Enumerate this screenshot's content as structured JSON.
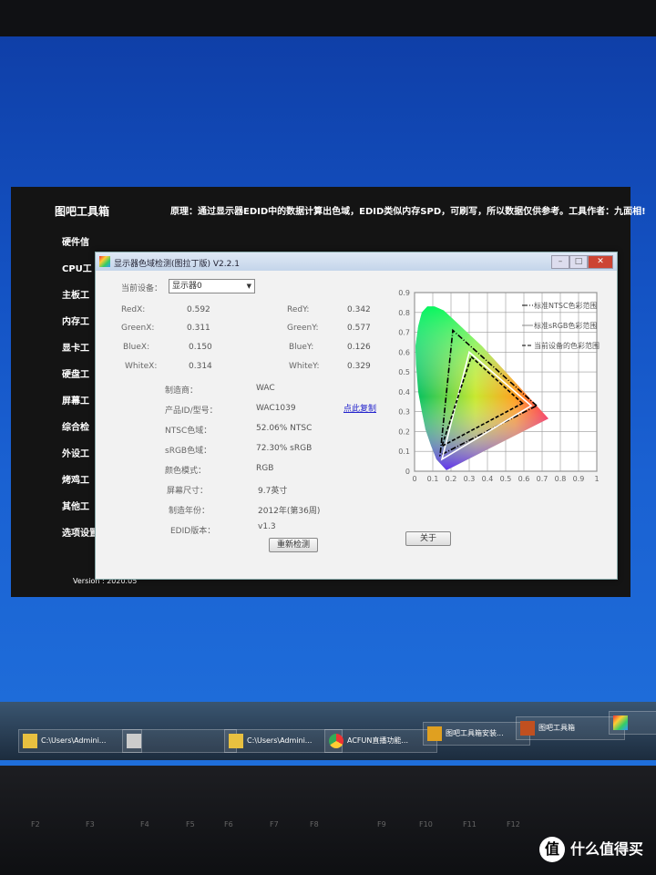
{
  "toolbox": {
    "title": "图吧工具箱",
    "principle": "原理：通过显示器EDID中的数据计算出色域，EDID类似内存SPD，可刷写，所以数据仅供参考。工具作者：九面相!",
    "menu": [
      "硬件信",
      "CPU工",
      "主板工",
      "内存工",
      "显卡工",
      "硬盘工",
      "屏幕工",
      "综合检",
      "外设工",
      "烤鸡工",
      "其他工",
      "选项设置"
    ],
    "version": "Version : 2020.05"
  },
  "dialog": {
    "title": "显示器色域检测(图拉丁版) V2.2.1",
    "device_label": "当前设备：",
    "device_value": "显示器0",
    "coords": {
      "redx_label": "RedX:",
      "redx": "0.592",
      "redy_label": "RedY:",
      "redy": "0.342",
      "greenx_label": "GreenX:",
      "greenx": "0.311",
      "greeny_label": "GreenY:",
      "greeny": "0.577",
      "bluex_label": "BlueX:",
      "bluex": "0.150",
      "bluey_label": "BlueY:",
      "bluey": "0.126",
      "whitex_label": "WhiteX:",
      "whitex": "0.314",
      "whitey_label": "WhiteY:",
      "whitey": "0.329"
    },
    "info": [
      {
        "label": "制造商：",
        "value": "WAC"
      },
      {
        "label": "产品ID/型号：",
        "value": "WAC1039"
      },
      {
        "label": "NTSC色域：",
        "value": "52.06% NTSC"
      },
      {
        "label": "sRGB色域：",
        "value": "72.30% sRGB"
      },
      {
        "label": "颜色模式：",
        "value": "RGB"
      },
      {
        "label": "屏幕尺寸：",
        "value": "9.7英寸"
      },
      {
        "label": "制造年份：",
        "value": "2012年(第36周)"
      },
      {
        "label": "EDID版本：",
        "value": "v1.3"
      }
    ],
    "copy_link": "点此复制",
    "recheck_button": "重新检测",
    "about_button": "关于"
  },
  "chart_data": {
    "type": "scatter",
    "xlim": [
      0,
      1
    ],
    "ylim": [
      0,
      0.9
    ],
    "x_ticks": [
      "0",
      "0.1",
      "0.2",
      "0.3",
      "0.4",
      "0.5",
      "0.6",
      "0.7",
      "0.8",
      "0.9",
      "1"
    ],
    "y_ticks": [
      "0",
      "0.1",
      "0.2",
      "0.3",
      "0.4",
      "0.5",
      "0.6",
      "0.7",
      "0.8",
      "0.9"
    ],
    "grid": true,
    "legend": [
      "标准NTSC色彩范围",
      "标准sRGB色彩范围",
      "当前设备的色彩范围"
    ],
    "legend_position": "top-right",
    "series": [
      {
        "name": "标准NTSC色彩范围",
        "style": "dash-dot",
        "color": "#000000",
        "x": [
          0.67,
          0.21,
          0.14
        ],
        "y": [
          0.33,
          0.71,
          0.08
        ]
      },
      {
        "name": "标准sRGB色彩范围",
        "style": "solid",
        "color": "#ffffff",
        "x": [
          0.64,
          0.3,
          0.15
        ],
        "y": [
          0.33,
          0.6,
          0.06
        ]
      },
      {
        "name": "当前设备的色彩范围",
        "style": "dashed",
        "color": "#000000",
        "x": [
          0.592,
          0.311,
          0.15
        ],
        "y": [
          0.342,
          0.577,
          0.126
        ]
      }
    ]
  },
  "taskbar": {
    "items": [
      "C:\\Users\\Admini...",
      "",
      "C:\\Users\\Admini...",
      "ACFUN直播功能...",
      "图吧工具箱安装...",
      "图吧工具箱",
      ""
    ]
  },
  "keyboard": {
    "keys": [
      "F2",
      "F3",
      "F4",
      "F5",
      "F6",
      "F7",
      "F8",
      "F9",
      "F10",
      "F11",
      "F12"
    ]
  },
  "watermark": "什么值得买"
}
